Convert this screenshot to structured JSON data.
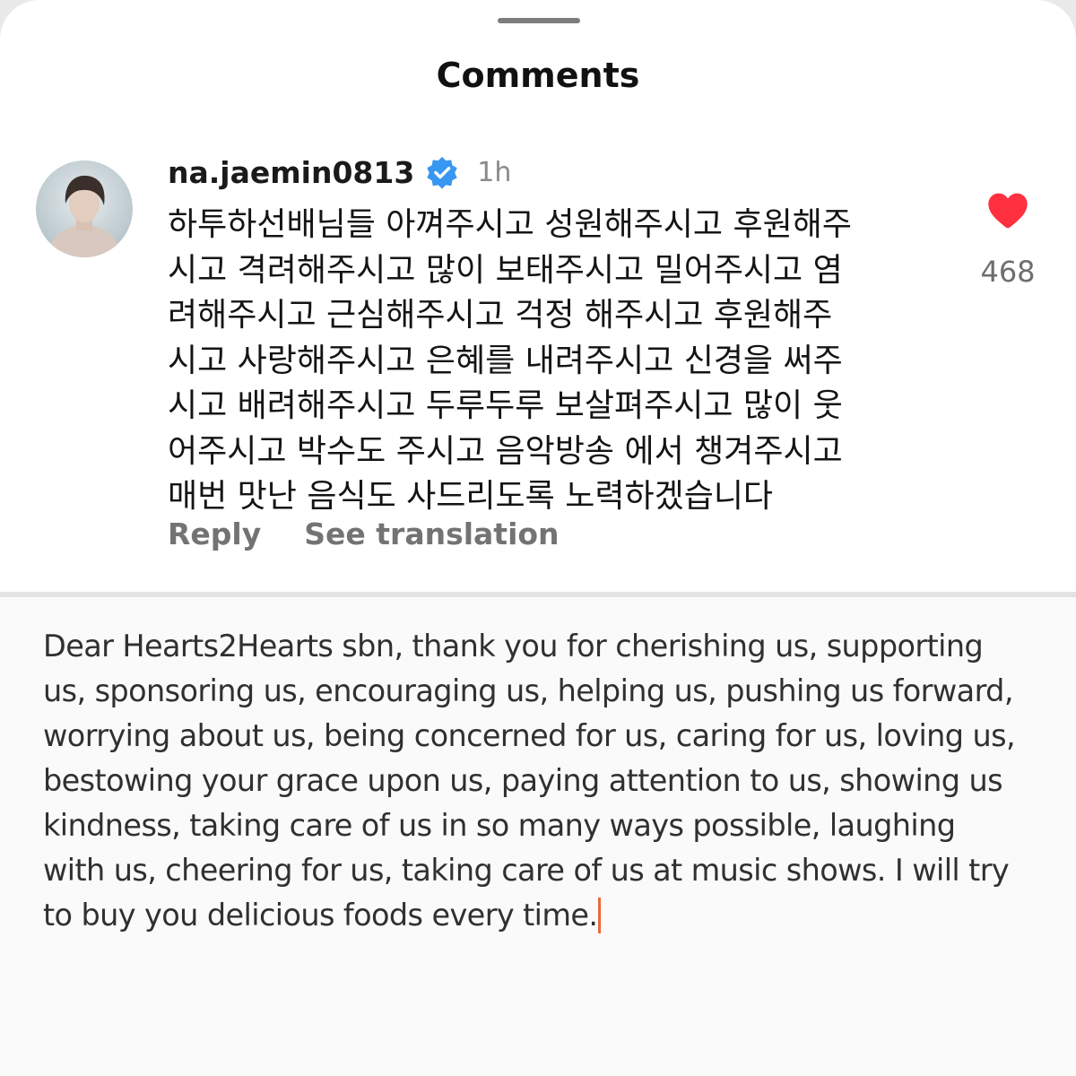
{
  "sheet": {
    "title": "Comments"
  },
  "comment": {
    "username": "na.jaemin0813",
    "verified": true,
    "time": "1h",
    "text": "하투하선배님들 아껴주시고 성원해주시고 후원해주\n시고 격려해주시고 많이 보태주시고 밀어주시고 염\n려해주시고 근심해주시고 걱정 해주시고 후원해주\n시고 사랑해주시고 은혜를 내려주시고 신경을 써주\n시고 배려해주시고 두루두루 보살펴주시고 많이 웃\n어주시고 박수도 주시고 음악방송 에서 챙겨주시고\n매번 맛난 음식도 사드리도록 노력하겠습니다",
    "reply_label": "Reply",
    "see_translation_label": "See translation",
    "like_count": "468",
    "liked": true
  },
  "translation": {
    "text": "Dear Hearts2Hearts sbn, thank you for cherishing us, supporting\nus, sponsoring us, encouraging us, helping us, pushing us forward,\nworrying about us, being concerned for us, caring for us, loving us,\nbestowing your grace upon us, paying attention to us, showing us\nkindness, taking care of us in so many ways possible, laughing\nwith us, cheering for us, taking care of us at music shows. I will try\nto buy you delicious foods every time."
  },
  "colors": {
    "verified_badge": "#3897f0",
    "heart": "#ff3040",
    "text_cursor": "#e8693a"
  },
  "icons": {
    "verified": "verified-badge-icon",
    "like": "heart-icon"
  }
}
